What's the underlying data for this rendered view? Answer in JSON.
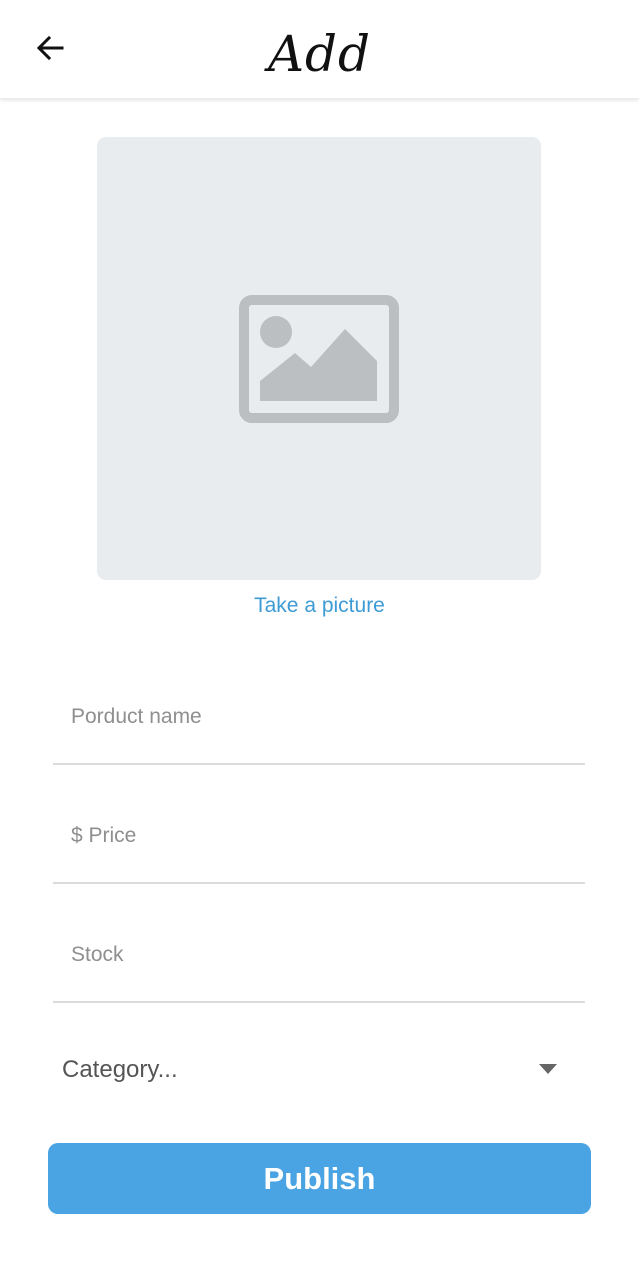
{
  "header": {
    "title": "Add",
    "back_icon": "arrow-left-icon"
  },
  "photo": {
    "placeholder_icon": "image-placeholder-icon",
    "take_picture_label": "Take a picture"
  },
  "form": {
    "product_name": {
      "placeholder": "Porduct name",
      "value": ""
    },
    "price": {
      "placeholder": "$ Price",
      "value": ""
    },
    "stock": {
      "placeholder": "Stock",
      "value": ""
    },
    "category": {
      "selected": "Category...",
      "icon": "caret-down-icon"
    }
  },
  "actions": {
    "publish_label": "Publish"
  },
  "colors": {
    "accent": "#4aa3e2",
    "link": "#3d9bd6",
    "placeholder_bg": "#e8ecef",
    "placeholder_icon": "#bcbfc1"
  }
}
